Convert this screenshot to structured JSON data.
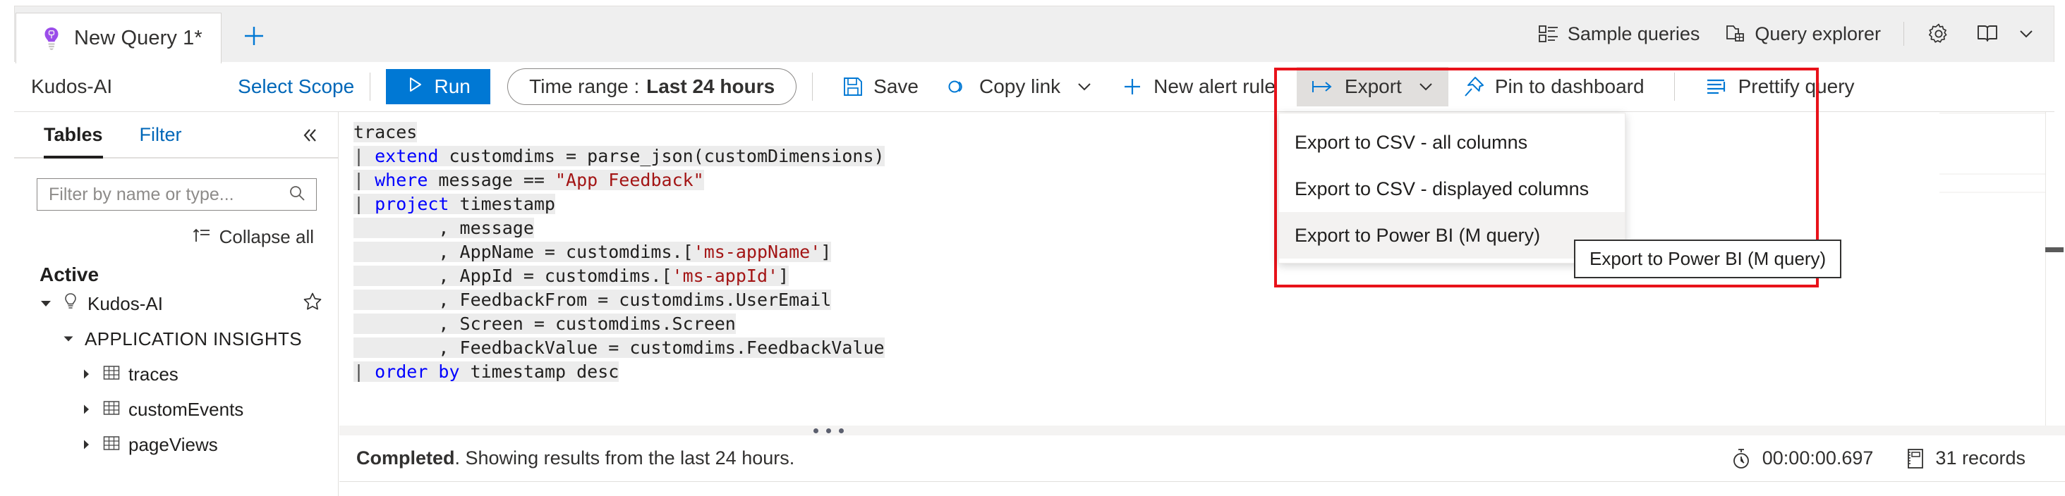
{
  "tabs": {
    "active_label": "New Query 1*",
    "add_tab_name": "add-tab",
    "bulb_icon": "lightbulb-icon"
  },
  "top_toolbar": {
    "sample_queries": "Sample queries",
    "query_explorer": "Query explorer",
    "settings_icon": "gear-icon",
    "help_icon": "book-icon",
    "chevron_icon": "chevron-down-icon"
  },
  "command_bar": {
    "scope_name": "Kudos-AI",
    "select_scope": "Select Scope",
    "run": "Run",
    "time_range_label": "Time range :",
    "time_range_value": "Last 24 hours",
    "save": "Save",
    "copy_link": "Copy link",
    "new_alert_rule": "New alert rule",
    "export": "Export",
    "pin_to_dashboard": "Pin to dashboard",
    "prettify_query": "Prettify query"
  },
  "export_menu": {
    "items": [
      {
        "label": "Export to CSV - all columns",
        "hover": false
      },
      {
        "label": "Export to CSV - displayed columns",
        "hover": false
      },
      {
        "label": "Export to Power BI (M query)",
        "hover": true
      }
    ],
    "tooltip": "Export to Power BI (M query)",
    "highlight_color": "#e8121a"
  },
  "left_pane": {
    "tab_tables": "Tables",
    "tab_filter": "Filter",
    "collapse_pane_icon": "chevron-double-left-icon",
    "filter_placeholder": "Filter by name or type...",
    "filter_value": "",
    "search_icon": "search-icon",
    "collapse_all": "Collapse all",
    "group_title": "Active",
    "workspace": "Kudos-AI",
    "workspace_icon": "app-insights-icon",
    "favorite_icon": "star-icon",
    "category": "APPLICATION INSIGHTS",
    "tables": [
      {
        "name": "traces"
      },
      {
        "name": "customEvents"
      },
      {
        "name": "pageViews"
      }
    ]
  },
  "query": {
    "lines": [
      [
        {
          "t": "traces",
          "c": "plain"
        }
      ],
      [
        {
          "t": "| ",
          "c": "pipe"
        },
        {
          "t": "extend",
          "c": "kw"
        },
        {
          "t": " customdims = parse_json(customDimensions)",
          "c": "plain"
        }
      ],
      [
        {
          "t": "| ",
          "c": "pipe"
        },
        {
          "t": "where",
          "c": "kw"
        },
        {
          "t": " message == ",
          "c": "plain"
        },
        {
          "t": "\"App Feedback\"",
          "c": "str"
        }
      ],
      [
        {
          "t": "| ",
          "c": "pipe"
        },
        {
          "t": "project",
          "c": "kw"
        },
        {
          "t": " timestamp",
          "c": "plain"
        }
      ],
      [
        {
          "t": "        , message",
          "c": "plain"
        }
      ],
      [
        {
          "t": "        , AppName = customdims.[",
          "c": "plain"
        },
        {
          "t": "'ms-appName'",
          "c": "str"
        },
        {
          "t": "]",
          "c": "plain"
        }
      ],
      [
        {
          "t": "        , AppId = customdims.[",
          "c": "plain"
        },
        {
          "t": "'ms-appId'",
          "c": "str"
        },
        {
          "t": "]",
          "c": "plain"
        }
      ],
      [
        {
          "t": "        , FeedbackFrom = customdims.UserEmail",
          "c": "plain"
        }
      ],
      [
        {
          "t": "        , Screen = customdims.Screen",
          "c": "plain"
        }
      ],
      [
        {
          "t": "        , FeedbackValue = customdims.FeedbackValue",
          "c": "plain"
        }
      ],
      [
        {
          "t": "| ",
          "c": "pipe"
        },
        {
          "t": "order by",
          "c": "kw"
        },
        {
          "t": " timestamp desc",
          "c": "plain"
        }
      ]
    ],
    "collapse_results_icon": "chevron-double-up-icon"
  },
  "status_bar": {
    "status_word": "Completed",
    "status_rest": ". Showing results from the last 24 hours.",
    "duration_icon": "timer-icon",
    "duration": "00:00:00.697",
    "records_icon": "records-icon",
    "records": "31 records"
  }
}
